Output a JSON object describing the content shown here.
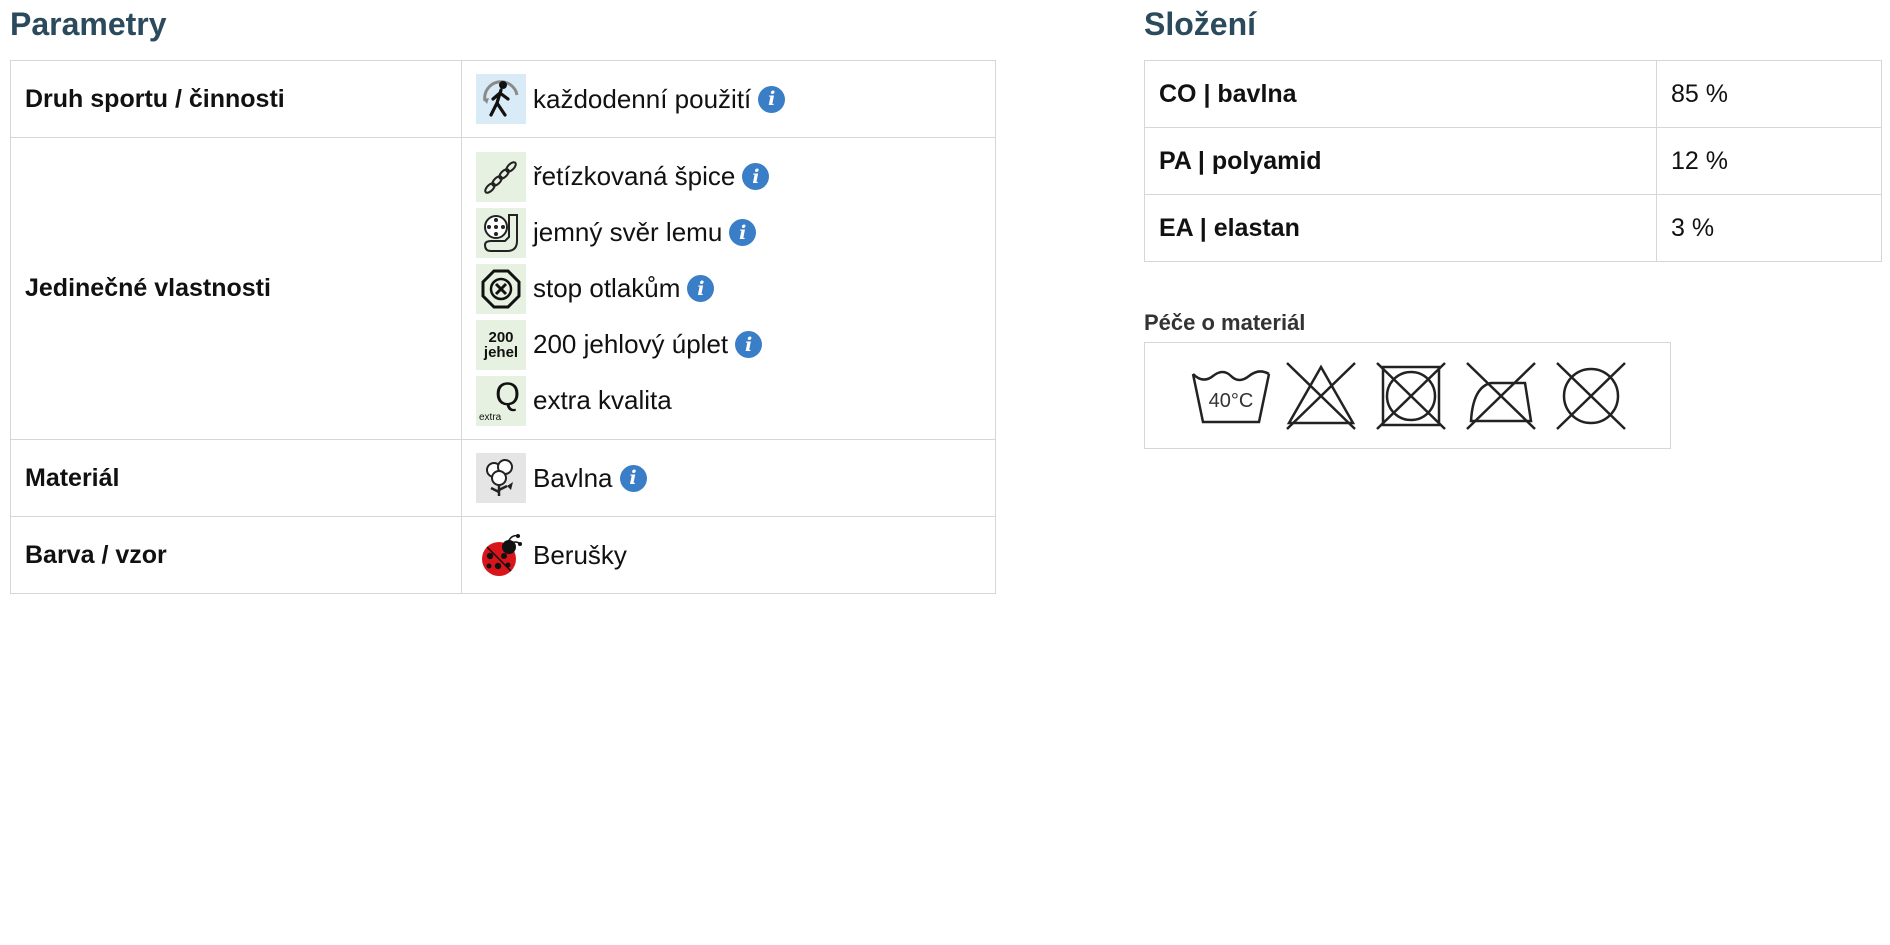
{
  "parametry": {
    "title": "Parametry",
    "rows": [
      {
        "label": "Druh sportu / činnosti",
        "items": [
          {
            "text": "každodenní použití",
            "icon": "walker-icon",
            "info": true
          }
        ]
      },
      {
        "label": "Jedinečné vlastnosti",
        "items": [
          {
            "text": "řetízkovaná špice",
            "icon": "chain-toe-icon",
            "info": true
          },
          {
            "text": "jemný svěr lemu",
            "icon": "soft-cuff-icon",
            "info": true
          },
          {
            "text": "stop otlakům",
            "icon": "stop-pressure-icon",
            "info": true
          },
          {
            "text": "200 jehlový úplet",
            "icon": "needles-200-icon",
            "icon_text_1": "200",
            "icon_text_2": "jehel",
            "info": true
          },
          {
            "text": "extra kvalita",
            "icon": "extra-quality-icon",
            "icon_text_1": "Q",
            "icon_text_2": "extra",
            "info": false
          }
        ]
      },
      {
        "label": "Materiál",
        "items": [
          {
            "text": "Bavlna",
            "icon": "cotton-icon",
            "info": true
          }
        ]
      },
      {
        "label": "Barva / vzor",
        "items": [
          {
            "text": "Berušky",
            "icon": "ladybug-icon",
            "info": false
          }
        ]
      }
    ]
  },
  "slozeni": {
    "title": "Složení",
    "rows": [
      {
        "material": "CO | bavlna",
        "percent": "85 %"
      },
      {
        "material": "PA | polyamid",
        "percent": "12 %"
      },
      {
        "material": "EA | elastan",
        "percent": "3 %"
      }
    ]
  },
  "care": {
    "title": "Péče o materiál",
    "wash_temp": "40°C",
    "icons": [
      "wash-40-icon",
      "no-bleach-icon",
      "no-tumble-dry-icon",
      "no-iron-icon",
      "no-dry-clean-icon"
    ]
  },
  "colors": {
    "heading": "#2b4a5c",
    "info_badge": "#3a7ec7",
    "border": "#d6d6d6"
  }
}
